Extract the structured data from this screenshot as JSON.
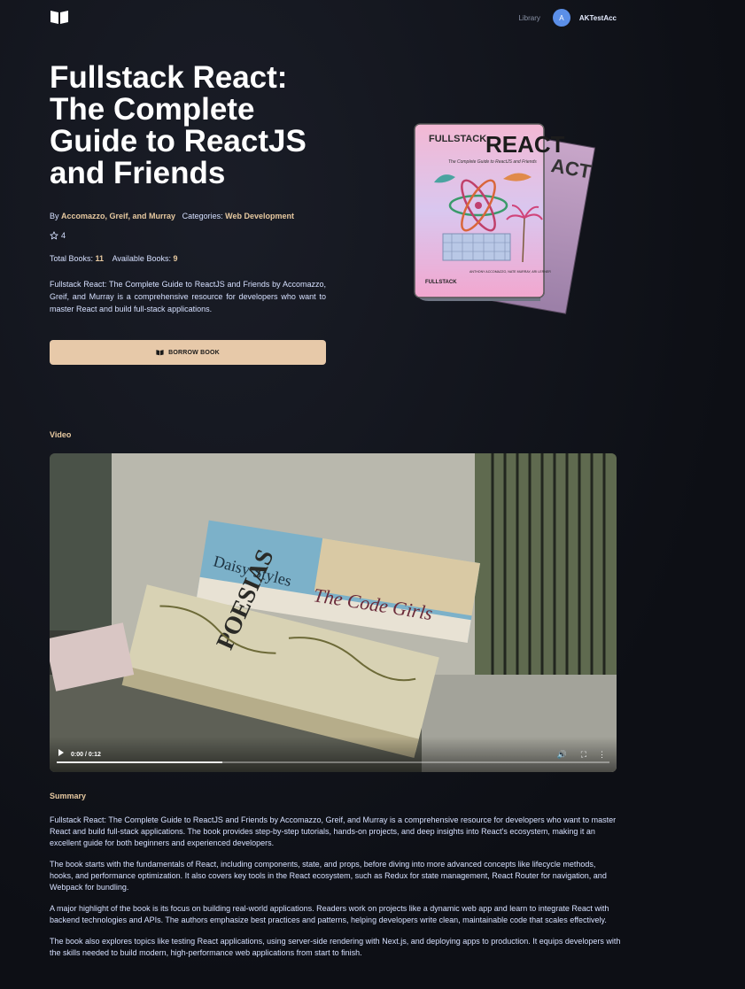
{
  "nav": {
    "library_label": "Library",
    "avatar_initial": "A",
    "username": "AKTestAcc"
  },
  "book": {
    "title": "Fullstack React: The Complete Guide to ReactJS and Friends",
    "by_label": "By",
    "authors": "Accomazzo, Greif, and Murray",
    "categories_label": "Categories:",
    "category": "Web Development",
    "rating": "4",
    "total_label": "Total Books:",
    "total": "11",
    "available_label": "Available Books:",
    "available": "9",
    "description": "Fullstack React: The Complete Guide to ReactJS and Friends by Accomazzo, Greif, and Murray is a comprehensive resource for developers who want to master React and build full-stack applications.",
    "borrow_label": "BORROW BOOK"
  },
  "cover": {
    "brand_top": "FULLSTACK",
    "brand_big": "REACT",
    "subtitle": "The Complete Guide to ReactJS and Friends",
    "authors": "ANTHONY ACCOMAZZO, NATE MURRAY, ARI LERNER",
    "footer": "FULLSTACK"
  },
  "video": {
    "section_label": "Video",
    "time": "0:00 / 0:12",
    "progress_percent": 30,
    "book1_author": "Daisy Styles",
    "book1_title": "The Code Girls",
    "book2_title": "POESIAS"
  },
  "summary": {
    "section_label": "Summary",
    "paragraphs": [
      "Fullstack React: The Complete Guide to ReactJS and Friends by Accomazzo, Greif, and Murray is a comprehensive resource for developers who want to master React and build full-stack applications. The book provides step-by-step tutorials, hands-on projects, and deep insights into React's ecosystem, making it an excellent guide for both beginners and experienced developers.",
      "The book starts with the fundamentals of React, including components, state, and props, before diving into more advanced concepts like lifecycle methods, hooks, and performance optimization. It also covers key tools in the React ecosystem, such as Redux for state management, React Router for navigation, and Webpack for bundling.",
      "A major highlight of the book is its focus on building real-world applications. Readers work on projects like a dynamic web app and learn to integrate React with backend technologies and APIs. The authors emphasize best practices and patterns, helping developers write clean, maintainable code that scales effectively.",
      "The book also explores topics like testing React applications, using server-side rendering with Next.js, and deploying apps to production. It equips developers with the skills needed to build modern, high-performance web applications from start to finish."
    ]
  },
  "colors": {
    "accent": "#e7c9a0",
    "background": "#0f1118",
    "button": "#e7c9a9",
    "avatar": "#5b8fe8"
  },
  "icons": {
    "logo": "open-book-icon",
    "rating": "star-outline-icon",
    "borrow": "book-icon",
    "video_volume": "volume-icon",
    "video_fullscreen": "fullscreen-icon",
    "video_more": "more-vertical-icon"
  }
}
